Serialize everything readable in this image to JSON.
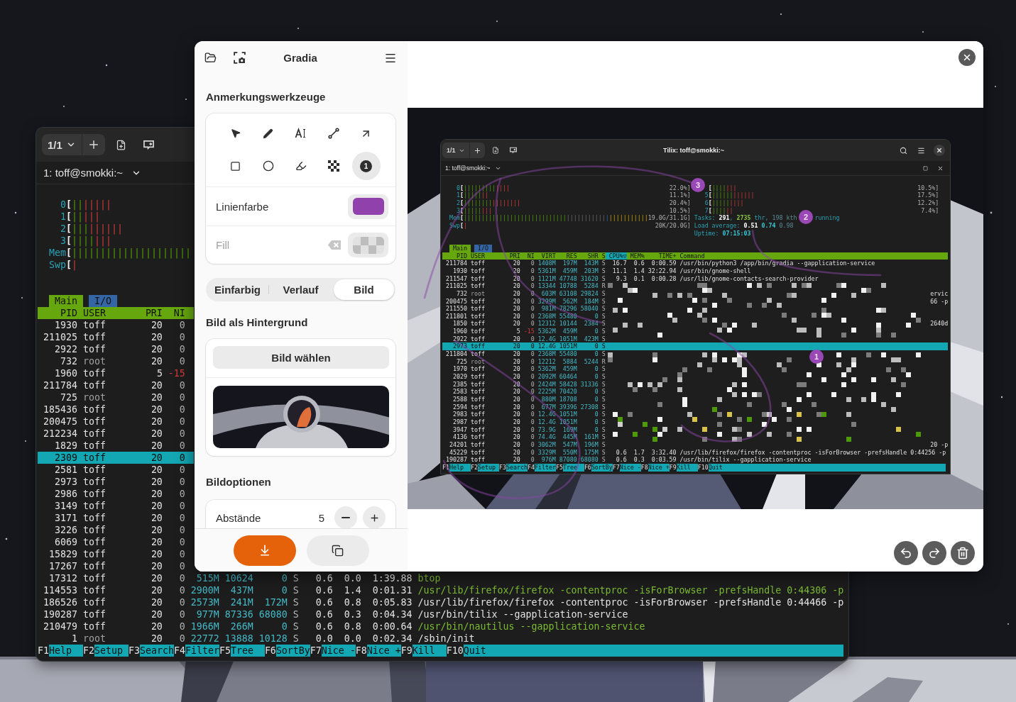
{
  "gradia": {
    "title": "Gradia",
    "annotation": {
      "title": "Anmerkungswerkzeuge",
      "tools": [
        {
          "kind": "select",
          "selected": false
        },
        {
          "kind": "pen",
          "selected": false
        },
        {
          "kind": "text",
          "selected": false
        },
        {
          "kind": "line",
          "selected": false
        },
        {
          "kind": "arrow",
          "selected": false
        },
        {
          "kind": "rectangle",
          "selected": false
        },
        {
          "kind": "ellipse",
          "selected": false
        },
        {
          "kind": "highlighter",
          "selected": false
        },
        {
          "kind": "pixelate",
          "selected": false
        },
        {
          "kind": "counter",
          "label": "1",
          "selected": true
        }
      ],
      "colors": [
        {
          "label": "Linienfarbe",
          "kind": "solid",
          "color": "#9141ac",
          "dimmed": false,
          "clearable": false
        },
        {
          "label": "Fill",
          "kind": "transparent",
          "dimmed": true,
          "clearable": true
        }
      ]
    },
    "background": {
      "modes": [
        {
          "label": "Einfarbig",
          "selected": false
        },
        {
          "label": "Verlauf",
          "selected": false
        },
        {
          "label": "Bild",
          "selected": true
        }
      ],
      "title": "Bild als Hintergrund",
      "choose_button": "Bild wählen"
    },
    "options": {
      "title": "Bildoptionen",
      "rows": [
        {
          "label": "Abstände",
          "value": "5"
        }
      ]
    },
    "preview": {
      "screenshot": {
        "session_count": "1/1",
        "title": "Tilix: toff@smokki:~",
        "session_title": "1: toff@smokki:~",
        "meters_left": [
          {
            "label": "0",
            "bracket": "[",
            "segments": [
              {
                "kind": "user",
                "text": "|||||||||"
              },
              {
                "kind": "kernel",
                "text": "||||"
              }
            ],
            "reading": "22.0%]"
          },
          {
            "label": "1",
            "bracket": "[",
            "segments": [
              {
                "kind": "user",
                "text": "|||||"
              },
              {
                "kind": "kernel",
                "text": "||"
              }
            ],
            "reading": "11.1%]"
          },
          {
            "label": "2",
            "bracket": "[",
            "segments": [
              {
                "kind": "user",
                "text": "||||||||"
              },
              {
                "kind": "kernel",
                "text": "||||||||"
              }
            ],
            "reading": "20.4%]"
          },
          {
            "label": "3",
            "bracket": "[",
            "segments": [
              {
                "kind": "user",
                "text": "|||||"
              },
              {
                "kind": "kernel",
                "text": "|||"
              }
            ],
            "reading": "10.5%]"
          },
          {
            "label": "Mem",
            "bracket": "[",
            "segments": [
              {
                "kind": "user",
                "text": "|||||||||||||||||||||||||||||"
              },
              {
                "kind": "dim",
                "text": "|||||||||||"
              },
              {
                "kind": "buffers",
                "text": "|"
              },
              {
                "kind": "cache",
                "text": "|||||||||||"
              }
            ],
            "reading": "19.0G/31.1G]"
          },
          {
            "label": "Swp",
            "bracket": "[",
            "segments": [
              {
                "kind": "kernel",
                "text": "|"
              }
            ],
            "reading": "20K/20.0G]"
          }
        ],
        "meters_right": [
          {
            "bracket": "[",
            "segments": [
              {
                "kind": "user",
                "text": "||||"
              },
              {
                "kind": "kernel",
                "text": "|||"
              }
            ],
            "reading": "10.5%]"
          },
          {
            "label": "5",
            "bracket": "[",
            "segments": [
              {
                "kind": "user",
                "text": "||||||"
              },
              {
                "kind": "kernel",
                "text": "||||||"
              }
            ],
            "reading": "17.5%]"
          },
          {
            "label": "6",
            "bracket": "[",
            "segments": [
              {
                "kind": "user",
                "text": "|||||"
              },
              {
                "kind": "kernel",
                "text": "||||"
              }
            ],
            "reading": "12.2%]"
          },
          {
            "label": "7",
            "bracket": "[",
            "segments": [
              {
                "kind": "user",
                "text": "||||"
              },
              {
                "kind": "kernel",
                "text": "||"
              }
            ],
            "reading": "7.4%]"
          }
        ],
        "info": [
          {
            "segments": [
              {
                "kind": "label",
                "text": "Tasks: "
              },
              {
                "kind": "value",
                "text": "291"
              },
              {
                "kind": "label",
                "text": ", "
              },
              {
                "kind": "thread",
                "text": "2735"
              },
              {
                "kind": "label",
                "text": " thr, "
              },
              {
                "kind": "dim",
                "text": "198"
              },
              {
                "kind": "dim",
                "text": " kth"
              }
            ],
            "trailing": "running"
          },
          {
            "segments": [
              {
                "kind": "label",
                "text": "Load average: "
              },
              {
                "kind": "value",
                "text": "0.51"
              },
              {
                "kind": "accent",
                "text": " 0.74"
              },
              {
                "kind": "dim",
                "text": " 0.98"
              }
            ]
          },
          {
            "segments": [
              {
                "kind": "label",
                "text": "Uptime: "
              },
              {
                "kind": "accent",
                "text": "07:15:03"
              }
            ]
          }
        ],
        "tabs": [
          {
            "label": "Main",
            "selected": true
          },
          {
            "label": "I/O",
            "selected": false
          }
        ],
        "columns": [
          {
            "label": "PID",
            "sorted": false
          },
          {
            "label": "USER",
            "sorted": false
          },
          {
            "label": "PRI",
            "sorted": false
          },
          {
            "label": "NI",
            "sorted": false
          },
          {
            "label": "VIRT",
            "sorted": false
          },
          {
            "label": "RES",
            "sorted": false
          },
          {
            "label": "SHR",
            "sorted": false
          },
          {
            "label": "S",
            "sorted": false
          },
          {
            "label": "CPU%▽",
            "sorted": true
          },
          {
            "label": "MEM%",
            "sorted": false
          },
          {
            "label": "TIME+",
            "sorted": false
          },
          {
            "label": "Command",
            "sorted": false
          }
        ],
        "rows": [
          {
            "pid": "211784",
            "user": "toff",
            "pri": "20",
            "ni": "0",
            "virt": "1408M",
            "res": "197M",
            "shr": "143M",
            "state": "S",
            "cpu": "16.7",
            "mem": "0.6",
            "time": "0:00.59",
            "command": "/usr/bin/python3 /app/bin/gradia --gapplication-service",
            "selected": false,
            "system_user": false,
            "negative_nice": false,
            "thread": false
          },
          {
            "pid": "1930",
            "user": "toff",
            "pri": "20",
            "ni": "0",
            "virt": "5361M",
            "res": "459M",
            "shr": "203M",
            "state": "S",
            "cpu": "11.1",
            "mem": "1.4",
            "time": "32:22.94",
            "command": "/usr/bin/gnome-shell",
            "selected": false,
            "system_user": false,
            "negative_nice": false,
            "thread": false
          },
          {
            "pid": "211547",
            "user": "toff",
            "pri": "20",
            "ni": "0",
            "virt": "1121M",
            "res": "47748",
            "shr": "31620",
            "state": "S",
            "cpu": "9.3",
            "mem": "0.1",
            "time": "0:00.28",
            "command": "/usr/lib/gnome-contacts-search-provider",
            "selected": false,
            "system_user": false,
            "negative_nice": false,
            "thread": false
          },
          {
            "pid": "211025",
            "user": "toff",
            "pri": "20",
            "ni": "0",
            "virt": "13344",
            "res": "10788",
            "shr": "5284",
            "state": "R",
            "selected": false,
            "system_user": false,
            "negative_nice": false
          },
          {
            "pid": "732",
            "user": "root",
            "pri": "20",
            "ni": "0",
            "virt": "603M",
            "res": "63108",
            "shr": "29824",
            "state": "S",
            "tail": "ervic",
            "selected": false,
            "system_user": true,
            "negative_nice": false
          },
          {
            "pid": "200475",
            "user": "toff",
            "pri": "20",
            "ni": "0",
            "virt": "3299M",
            "res": "562M",
            "shr": "184M",
            "state": "S",
            "tail": "66 -p",
            "selected": false,
            "system_user": false,
            "negative_nice": false
          },
          {
            "pid": "211550",
            "user": "toff",
            "pri": "20",
            "ni": "0",
            "virt": "981M",
            "res": "78296",
            "shr": "58040",
            "state": "S",
            "selected": false,
            "system_user": false,
            "negative_nice": false
          },
          {
            "pid": "211801",
            "user": "toff",
            "pri": "20",
            "ni": "0",
            "virt": "2368M",
            "res": "55480",
            "shr": "0",
            "state": "S",
            "selected": false,
            "system_user": false,
            "negative_nice": false
          },
          {
            "pid": "1850",
            "user": "toff",
            "pri": "20",
            "ni": "0",
            "virt": "12312",
            "res": "10144",
            "shr": "2384",
            "state": "S",
            "tail": "2640d",
            "selected": false,
            "system_user": false,
            "negative_nice": false
          },
          {
            "pid": "1960",
            "user": "toff",
            "pri": "5",
            "ni": "-15",
            "virt": "5362M",
            "res": "459M",
            "shr": "0",
            "state": "S",
            "selected": false,
            "system_user": false,
            "negative_nice": true
          },
          {
            "pid": "2922",
            "user": "toff",
            "pri": "20",
            "ni": "0",
            "virt": "12.4G",
            "res": "1051M",
            "shr": "423M",
            "state": "S",
            "selected": false,
            "system_user": false,
            "negative_nice": false
          },
          {
            "pid": "2973",
            "user": "toff",
            "pri": "20",
            "ni": "0",
            "virt": "12.4G",
            "res": "1051M",
            "shr": "0",
            "state": "S",
            "selected": true,
            "system_user": false,
            "negative_nice": false
          },
          {
            "pid": "211804",
            "user": "toff",
            "pri": "20",
            "ni": "0",
            "virt": "2368M",
            "res": "55480",
            "shr": "0",
            "state": "S",
            "selected": false,
            "system_user": false,
            "negative_nice": false
          },
          {
            "pid": "725",
            "user": "root",
            "pri": "20",
            "ni": "0",
            "virt": "12212",
            "res": "5884",
            "shr": "5244",
            "state": "R",
            "selected": false,
            "system_user": true,
            "negative_nice": false
          },
          {
            "pid": "1970",
            "user": "toff",
            "pri": "20",
            "ni": "0",
            "virt": "5362M",
            "res": "459M",
            "shr": "0",
            "state": "S",
            "selected": false,
            "system_user": false,
            "negative_nice": false
          },
          {
            "pid": "2029",
            "user": "toff",
            "pri": "20",
            "ni": "0",
            "virt": "2092M",
            "res": "60464",
            "shr": "0",
            "state": "S",
            "selected": false,
            "system_user": false,
            "negative_nice": false
          },
          {
            "pid": "2385",
            "user": "toff",
            "pri": "20",
            "ni": "0",
            "virt": "2424M",
            "res": "58428",
            "shr": "31336",
            "state": "S",
            "selected": false,
            "system_user": false,
            "negative_nice": false
          },
          {
            "pid": "2583",
            "user": "toff",
            "pri": "20",
            "ni": "0",
            "virt": "2225M",
            "res": "70420",
            "shr": "0",
            "state": "S",
            "selected": false,
            "system_user": false,
            "negative_nice": false
          },
          {
            "pid": "2588",
            "user": "toff",
            "pri": "20",
            "ni": "0",
            "virt": "880M",
            "res": "18708",
            "shr": "0",
            "state": "S",
            "selected": false,
            "system_user": false,
            "negative_nice": false
          },
          {
            "pid": "2594",
            "user": "toff",
            "pri": "20",
            "ni": "0",
            "virt": "677M",
            "res": "39396",
            "shr": "27308",
            "state": "S",
            "selected": false,
            "system_user": false,
            "negative_nice": false
          },
          {
            "pid": "2983",
            "user": "toff",
            "pri": "20",
            "ni": "0",
            "virt": "12.4G",
            "res": "1051M",
            "shr": "0",
            "state": "S",
            "selected": false,
            "system_user": false,
            "negative_nice": false
          },
          {
            "pid": "2987",
            "user": "toff",
            "pri": "20",
            "ni": "0",
            "virt": "12.4G",
            "res": "1051M",
            "shr": "0",
            "state": "S",
            "selected": false,
            "system_user": false,
            "negative_nice": false
          },
          {
            "pid": "3947",
            "user": "toff",
            "pri": "20",
            "ni": "0",
            "virt": "73.9G",
            "res": "169M",
            "shr": "0",
            "state": "S",
            "selected": false,
            "system_user": false,
            "negative_nice": false
          },
          {
            "pid": "4136",
            "user": "toff",
            "pri": "20",
            "ni": "0",
            "virt": "74.4G",
            "res": "445M",
            "shr": "161M",
            "state": "S",
            "selected": false,
            "system_user": false,
            "negative_nice": false
          },
          {
            "pid": "24201",
            "user": "toff",
            "pri": "20",
            "ni": "0",
            "virt": "3062M",
            "res": "547M",
            "shr": "196M",
            "state": "S",
            "tail": "20 -p",
            "selected": false,
            "system_user": false,
            "negative_nice": false
          },
          {
            "pid": "45229",
            "user": "toff",
            "pri": "20",
            "ni": "0",
            "virt": "3329M",
            "res": "550M",
            "shr": "175M",
            "state": "S",
            "cpu": "0.6",
            "mem": "1.7",
            "time": "3:32.40",
            "command": "/usr/lib/firefox/firefox -contentproc -isForBrowser -prefsHandle 0:44256 -p",
            "selected": false,
            "system_user": false,
            "negative_nice": false,
            "thread": false
          },
          {
            "pid": "190287",
            "user": "toff",
            "pri": "20",
            "ni": "0",
            "virt": "976M",
            "res": "87080",
            "shr": "68080",
            "state": "S",
            "cpu": "0.6",
            "mem": "0.3",
            "time": "0:03.59",
            "command": "/usr/bin/tilix --gapplication-service",
            "selected": false,
            "system_user": false,
            "negative_nice": false,
            "thread": false
          }
        ],
        "function_keys": [
          {
            "key": "F1",
            "label": "Help"
          },
          {
            "key": "F2",
            "label": "Setup"
          },
          {
            "key": "F3",
            "label": "Search"
          },
          {
            "key": "F4",
            "label": "Filter"
          },
          {
            "key": "F5",
            "label": "Tree"
          },
          {
            "key": "F6",
            "label": "SortBy"
          },
          {
            "key": "F7",
            "label": "Nice -"
          },
          {
            "key": "F8",
            "label": "Nice +"
          },
          {
            "key": "F9",
            "label": "Kill"
          },
          {
            "key": "F10",
            "label": "Quit"
          }
        ]
      },
      "markers": [
        {
          "label": "3"
        },
        {
          "label": "2"
        },
        {
          "label": "1"
        }
      ]
    }
  },
  "terminal": {
    "session_count": "1/1",
    "session_title": "1: toff@smokki:~",
    "meters_left": [
      {
        "label": "0",
        "bracket": "[",
        "segments": [
          {
            "kind": "user",
            "text": "||"
          },
          {
            "kind": "kernel",
            "text": "|||||"
          }
        ]
      },
      {
        "label": "1",
        "bracket": "[",
        "segments": [
          {
            "kind": "user",
            "text": "||"
          },
          {
            "kind": "kernel",
            "text": "|||"
          }
        ]
      },
      {
        "label": "2",
        "bracket": "[",
        "segments": [
          {
            "kind": "user",
            "text": "|||"
          },
          {
            "kind": "kernel",
            "text": "||||||"
          }
        ]
      },
      {
        "label": "3",
        "bracket": "[",
        "segments": [
          {
            "kind": "user",
            "text": "||||"
          },
          {
            "kind": "kernel",
            "text": "|||"
          }
        ]
      },
      {
        "label": "Mem",
        "bracket": "[",
        "segments": [
          {
            "kind": "user",
            "text": "|||||||||||||||||||||"
          }
        ]
      },
      {
        "label": "Swp",
        "bracket": "[",
        "segments": [
          {
            "kind": "kernel",
            "text": "|"
          }
        ]
      }
    ],
    "tabs": [
      {
        "label": "Main",
        "selected": true
      },
      {
        "label": "I/O",
        "selected": false
      }
    ],
    "columns": [
      {
        "label": "PID",
        "sorted": false
      },
      {
        "label": "USER",
        "sorted": false
      },
      {
        "label": "PRI",
        "sorted": false
      },
      {
        "label": "NI",
        "sorted": false
      }
    ],
    "rows": [
      {
        "pid": "1930",
        "user": "toff",
        "pri": "20",
        "ni": "0",
        "selected": false,
        "system_user": false,
        "negative_nice": false
      },
      {
        "pid": "211025",
        "user": "toff",
        "pri": "20",
        "ni": "0",
        "selected": false,
        "system_user": false,
        "negative_nice": false
      },
      {
        "pid": "2922",
        "user": "toff",
        "pri": "20",
        "ni": "0",
        "selected": false,
        "system_user": false,
        "negative_nice": false
      },
      {
        "pid": "732",
        "user": "root",
        "pri": "20",
        "ni": "0",
        "selected": false,
        "system_user": true,
        "negative_nice": false
      },
      {
        "pid": "1960",
        "user": "toff",
        "pri": "5",
        "ni": "-15",
        "selected": false,
        "system_user": false,
        "negative_nice": true
      },
      {
        "pid": "211784",
        "user": "toff",
        "pri": "20",
        "ni": "0",
        "selected": false,
        "system_user": false,
        "negative_nice": false
      },
      {
        "pid": "725",
        "user": "root",
        "pri": "20",
        "ni": "0",
        "selected": false,
        "system_user": true,
        "negative_nice": false
      },
      {
        "pid": "185436",
        "user": "toff",
        "pri": "20",
        "ni": "0",
        "selected": false,
        "system_user": false,
        "negative_nice": false
      },
      {
        "pid": "200475",
        "user": "toff",
        "pri": "20",
        "ni": "0",
        "selected": false,
        "system_user": false,
        "negative_nice": false
      },
      {
        "pid": "212234",
        "user": "toff",
        "pri": "20",
        "ni": "0",
        "selected": false,
        "system_user": false,
        "negative_nice": false
      },
      {
        "pid": "1829",
        "user": "toff",
        "pri": "20",
        "ni": "0",
        "selected": false,
        "system_user": false,
        "negative_nice": false
      },
      {
        "pid": "2309",
        "user": "toff",
        "pri": "20",
        "ni": "0",
        "selected": true,
        "system_user": false,
        "negative_nice": false
      },
      {
        "pid": "2581",
        "user": "toff",
        "pri": "20",
        "ni": "0",
        "selected": false,
        "system_user": false,
        "negative_nice": false
      },
      {
        "pid": "2973",
        "user": "toff",
        "pri": "20",
        "ni": "0",
        "selected": false,
        "system_user": false,
        "negative_nice": false
      },
      {
        "pid": "2986",
        "user": "toff",
        "pri": "20",
        "ni": "0",
        "selected": false,
        "system_user": false,
        "negative_nice": false
      },
      {
        "pid": "3149",
        "user": "toff",
        "pri": "20",
        "ni": "0",
        "selected": false,
        "system_user": false,
        "negative_nice": false
      },
      {
        "pid": "3171",
        "user": "toff",
        "pri": "20",
        "ni": "0",
        "selected": false,
        "system_user": false,
        "negative_nice": false
      },
      {
        "pid": "3226",
        "user": "toff",
        "pri": "20",
        "ni": "0",
        "selected": false,
        "system_user": false,
        "negative_nice": false
      },
      {
        "pid": "6069",
        "user": "toff",
        "pri": "20",
        "ni": "0",
        "selected": false,
        "system_user": false,
        "negative_nice": false
      },
      {
        "pid": "15829",
        "user": "toff",
        "pri": "20",
        "ni": "0",
        "selected": false,
        "system_user": false,
        "negative_nice": false
      },
      {
        "pid": "17267",
        "user": "toff",
        "pri": "20",
        "ni": "0",
        "selected": false,
        "system_user": false,
        "negative_nice": false
      },
      {
        "pid": "17312",
        "user": "toff",
        "pri": "20",
        "ni": "0",
        "virt": "515M",
        "res": "10624",
        "shr": "0",
        "state": "S",
        "cpu": "0.6",
        "mem": "0.0",
        "time": "1:39.88",
        "command": "btop",
        "selected": false,
        "system_user": false,
        "negative_nice": false,
        "thread": true
      },
      {
        "pid": "114553",
        "user": "toff",
        "pri": "20",
        "ni": "0",
        "virt": "2900M",
        "res": "437M",
        "shr": "0",
        "state": "S",
        "cpu": "0.6",
        "mem": "1.4",
        "time": "0:01.31",
        "command": "/usr/lib/firefox/firefox -contentproc -isForBrowser -prefsHandle 0:44306 -p",
        "selected": false,
        "system_user": false,
        "negative_nice": false,
        "thread": true
      },
      {
        "pid": "186526",
        "user": "toff",
        "pri": "20",
        "ni": "0",
        "virt": "2573M",
        "res": "241M",
        "shr": "172M",
        "state": "S",
        "cpu": "0.6",
        "mem": "0.8",
        "time": "0:05.83",
        "command": "/usr/lib/firefox/firefox -contentproc -isForBrowser -prefsHandle 0:44466 -p",
        "selected": false,
        "system_user": false,
        "negative_nice": false,
        "thread": false
      },
      {
        "pid": "190287",
        "user": "toff",
        "pri": "20",
        "ni": "0",
        "virt": "977M",
        "res": "87336",
        "shr": "68080",
        "state": "S",
        "cpu": "0.6",
        "mem": "0.3",
        "time": "0:04.34",
        "command": "/usr/bin/tilix --gapplication-service",
        "selected": false,
        "system_user": false,
        "negative_nice": false,
        "thread": false
      },
      {
        "pid": "210479",
        "user": "toff",
        "pri": "20",
        "ni": "0",
        "virt": "1966M",
        "res": "266M",
        "shr": "0",
        "state": "S",
        "cpu": "0.6",
        "mem": "0.8",
        "time": "0:00.64",
        "command": "/usr/bin/nautilus --gapplication-service",
        "selected": false,
        "system_user": false,
        "negative_nice": false,
        "thread": true
      },
      {
        "pid": "1",
        "user": "root",
        "pri": "20",
        "ni": "0",
        "virt": "22772",
        "res": "13888",
        "shr": "10128",
        "state": "S",
        "cpu": "0.0",
        "mem": "0.0",
        "time": "0:02.34",
        "command": "/sbin/init",
        "selected": false,
        "system_user": true,
        "negative_nice": false,
        "thread": false
      }
    ],
    "function_keys": [
      {
        "key": "F1",
        "label": "Help"
      },
      {
        "key": "F2",
        "label": "Setup"
      },
      {
        "key": "F3",
        "label": "Search"
      },
      {
        "key": "F4",
        "label": "Filter"
      },
      {
        "key": "F5",
        "label": "Tree"
      },
      {
        "key": "F6",
        "label": "SortBy"
      },
      {
        "key": "F7",
        "label": "Nice -"
      },
      {
        "key": "F8",
        "label": "Nice +"
      },
      {
        "key": "F9",
        "label": "Kill"
      },
      {
        "key": "F10",
        "label": "Quit"
      }
    ]
  }
}
